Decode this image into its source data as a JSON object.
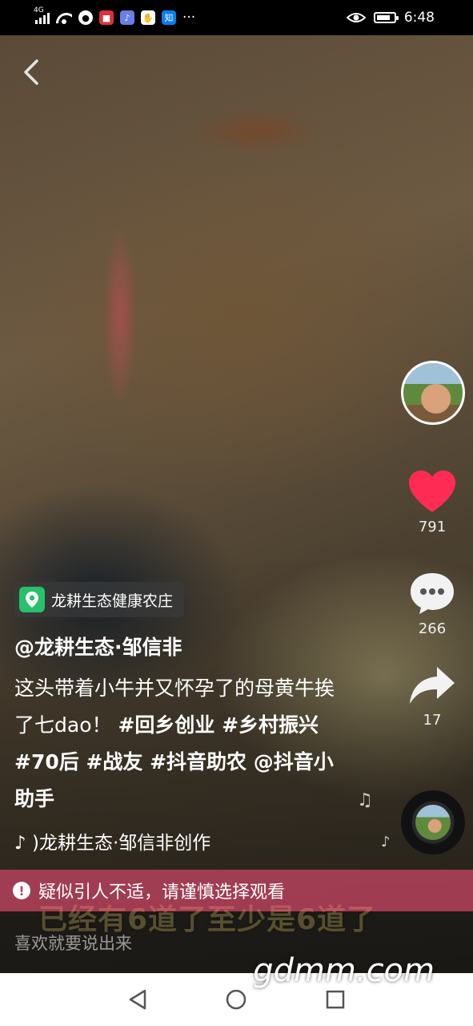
{
  "status_bar": {
    "network": "4G",
    "time": "6:48",
    "more": "···",
    "zhihu": "知"
  },
  "location": {
    "label": "龙耕生态健康农庄"
  },
  "author": {
    "handle": "@龙耕生态·邹信非"
  },
  "description": {
    "text": "这头带着小牛并又怀孕了的母黄牛挨了七dao！",
    "tags": "#回乡创业 #乡村振兴 #70后 #战友 #抖音助农 @抖音小助手"
  },
  "music": {
    "label": ")龙耕生态·邹信非创作"
  },
  "actions": {
    "likes": "791",
    "comments": "266",
    "shares": "17"
  },
  "warning": {
    "text": "疑似引人不适，请谨慎选择观看"
  },
  "subtitle": {
    "text": "已经有6道了至少是6道了"
  },
  "comment_input": {
    "placeholder": "喜欢就要说出来"
  },
  "watermark": {
    "text": "gdmm.com"
  },
  "colors": {
    "like_red": "#fe2c55",
    "location_green": "#28c06a",
    "warning_bar": "#c84664"
  }
}
